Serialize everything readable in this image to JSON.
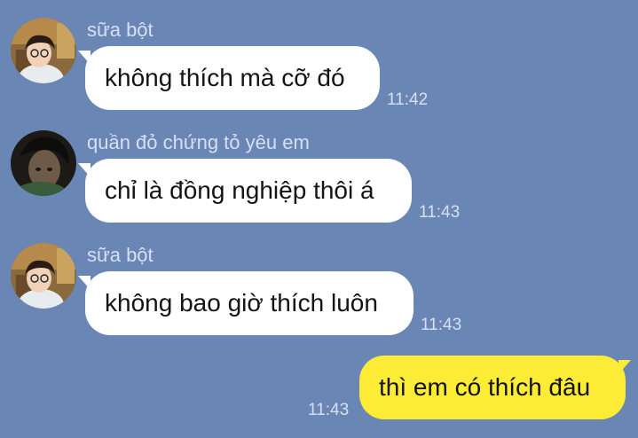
{
  "messages": [
    {
      "direction": "incoming",
      "sender": "sữa bột",
      "text": "không thích mà cỡ đó",
      "time": "11:42"
    },
    {
      "direction": "incoming",
      "sender": "quần đỏ chứng tỏ yêu em",
      "text": "chỉ là đồng nghiệp thôi á",
      "time": "11:43"
    },
    {
      "direction": "incoming",
      "sender": "sữa bột",
      "text": "không bao giờ thích luôn",
      "time": "11:43"
    },
    {
      "direction": "outgoing",
      "text": "thì em có thích đâu",
      "time": "11:43"
    }
  ],
  "colors": {
    "background": "#6a86b5",
    "incoming_bubble": "#ffffff",
    "outgoing_bubble": "#fcec35",
    "meta_text": "#d6e0f2"
  }
}
